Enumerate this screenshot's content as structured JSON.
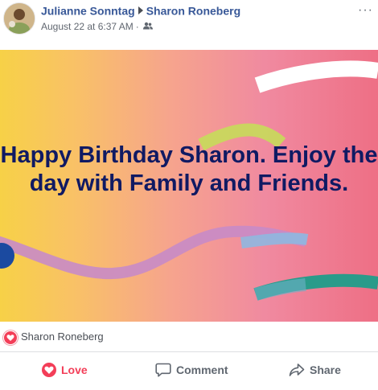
{
  "post": {
    "author": "Julianne Sonntag",
    "recipient": "Sharon Roneberg",
    "timestamp": "August 22 at 6:37 AM",
    "separator": "·",
    "audience_icon": "friends-icon",
    "more_label": "···"
  },
  "banner": {
    "message": "Happy Birthday Sharon. Enjoy the day with Family and Friends.",
    "gradient_start": "#f7d147",
    "gradient_end": "#ee6f85",
    "text_color": "#101a63"
  },
  "reactions": {
    "icon": "love-reaction-icon",
    "names": "Sharon Roneberg"
  },
  "actions": {
    "love_label": "Love",
    "comment_label": "Comment",
    "share_label": "Share"
  },
  "colors": {
    "link": "#385898",
    "love": "#f33e58",
    "muted": "#606770"
  }
}
